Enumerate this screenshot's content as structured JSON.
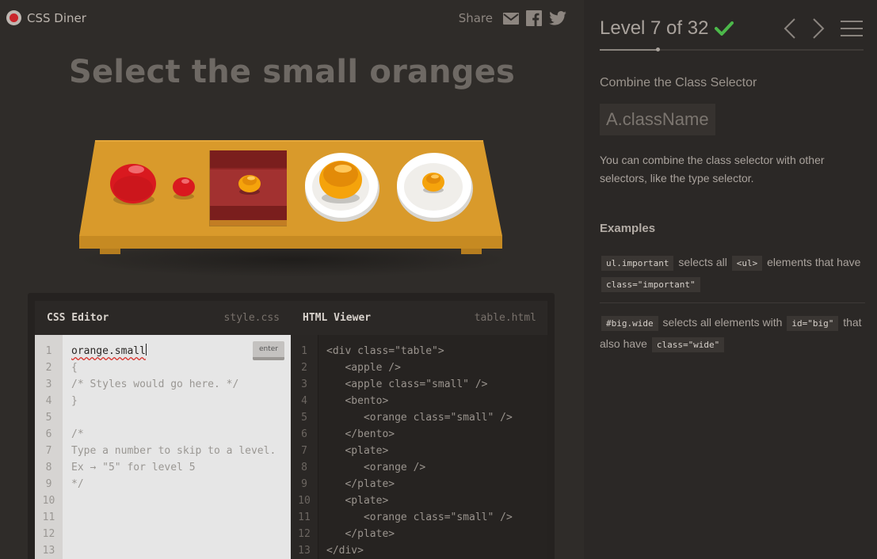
{
  "app": {
    "logo_text": "CSS Diner",
    "share_label": "Share",
    "order_text": "Select the small oranges"
  },
  "icons": {
    "logo": "plate-logo-icon",
    "email": "email-icon",
    "facebook": "facebook-icon",
    "twitter": "twitter-icon",
    "prev": "chevron-left-icon",
    "next": "chevron-right-icon",
    "menu": "hamburger-menu-icon",
    "check": "check-icon"
  },
  "colors": {
    "apple_red": "#d9191f",
    "orange": "#f5a30b",
    "table_wood": "#d99a2b",
    "bento": "#9b2a28",
    "check_green": "#4cb84a"
  },
  "table_items": [
    {
      "type": "apple",
      "size": "normal"
    },
    {
      "type": "apple",
      "size": "small"
    },
    {
      "type": "bento",
      "contains": "orange",
      "size": "small"
    },
    {
      "type": "plate",
      "contains": "orange",
      "size": "normal"
    },
    {
      "type": "plate",
      "contains": "orange",
      "size": "small"
    }
  ],
  "editor": {
    "css": {
      "title": "CSS Editor",
      "file": "style.css",
      "input_value": "orange.small",
      "enter_label": "enter",
      "line_numbers": [
        "1",
        "2",
        "3",
        "4",
        "5",
        "6",
        "7",
        "8",
        "9",
        "10",
        "11",
        "12",
        "13"
      ],
      "lines": [
        "{",
        "/* Styles would go here. */",
        "}",
        "",
        "/*",
        "Type a number to skip to a level.",
        "Ex → \"5\" for level 5",
        "*/"
      ]
    },
    "html": {
      "title": "HTML Viewer",
      "file": "table.html",
      "line_numbers": [
        "1",
        "2",
        "3",
        "4",
        "5",
        "6",
        "7",
        "8",
        "9",
        "10",
        "11",
        "12",
        "13"
      ],
      "lines": [
        "<div class=\"table\">",
        "   <apple />",
        "   <apple class=\"small\" />",
        "   <bento>",
        "      <orange class=\"small\" />",
        "   </bento>",
        "   <plate>",
        "      <orange />",
        "   </plate>",
        "   <plate>",
        "      <orange class=\"small\" />",
        "   </plate>",
        "</div>"
      ]
    }
  },
  "sidebar": {
    "level_text": "Level 7 of 32",
    "level_current": 7,
    "level_total": 32,
    "selector_name": "Combine the Class Selector",
    "syntax": "A.className",
    "hint": "You can combine the class selector with other selectors, like the type selector.",
    "examples_title": "Examples",
    "examples": [
      {
        "code1": "ul.important",
        "text1": "selects all",
        "code2": "<ul>",
        "text2": "elements that have",
        "code3": "class=\"important\""
      },
      {
        "code1": "#big.wide",
        "text1": "selects all elements with",
        "code2": "id=\"big\"",
        "text2": "that also have",
        "code3": "class=\"wide\""
      }
    ]
  }
}
